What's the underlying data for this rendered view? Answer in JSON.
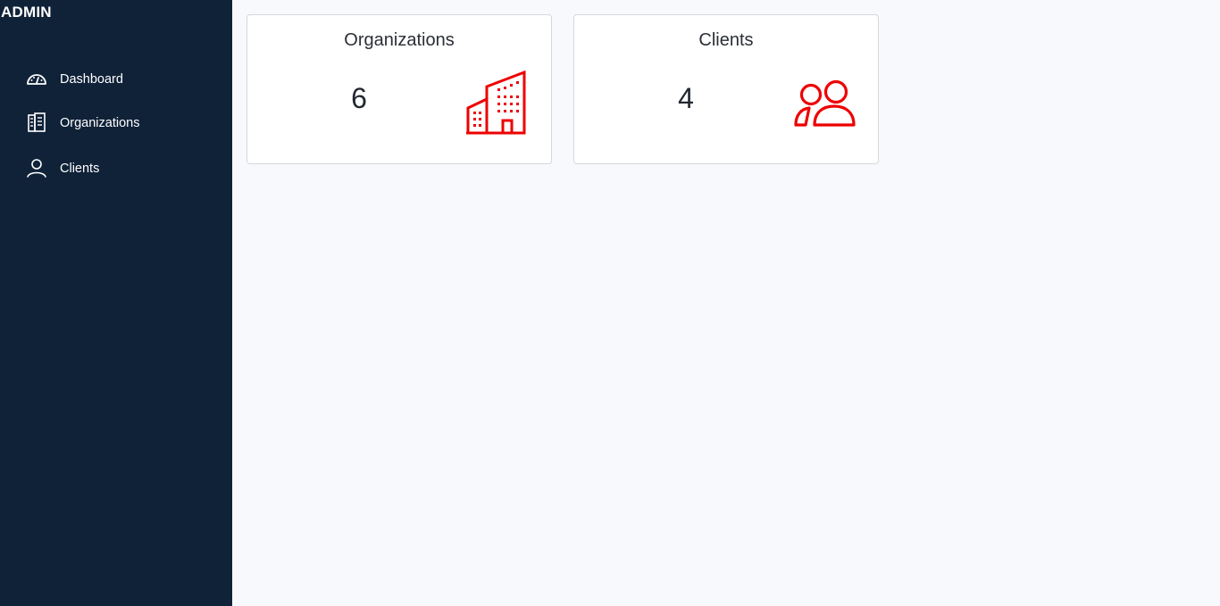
{
  "brand": "ADMIN",
  "sidebar": {
    "items": [
      {
        "label": "Dashboard",
        "icon": "dashboard-gauge-icon"
      },
      {
        "label": "Organizations",
        "icon": "building-icon"
      },
      {
        "label": "Clients",
        "icon": "person-icon"
      }
    ]
  },
  "cards": [
    {
      "title": "Organizations",
      "value": "6",
      "icon": "buildings-icon"
    },
    {
      "title": "Clients",
      "value": "4",
      "icon": "users-icon"
    }
  ],
  "colors": {
    "sidebar_bg": "#0f2238",
    "accent_red": "#ee0000",
    "page_bg": "#f8f9fd"
  }
}
